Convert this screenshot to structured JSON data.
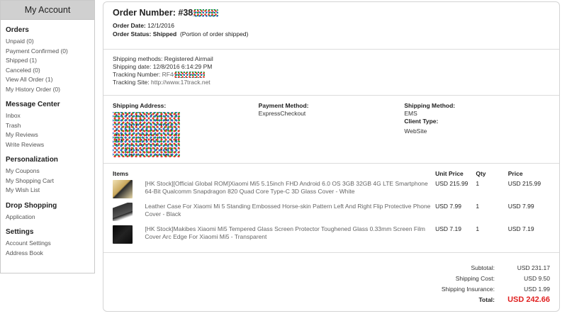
{
  "sidebar": {
    "title": "My Account",
    "sections": [
      {
        "title": "Orders",
        "links": [
          "Unpaid (0)",
          "Payment Confirmed (0)",
          "Shipped (1)",
          "Canceled (0)",
          "View All Order (1)",
          "My History Order (0)"
        ]
      },
      {
        "title": "Message Center",
        "links": [
          "Inbox",
          "Trash",
          "My Reviews",
          "Write Reviews"
        ]
      },
      {
        "title": "Personalization",
        "links": [
          "My Coupons",
          "My Shopping Cart",
          "My Wish List"
        ]
      },
      {
        "title": "Drop Shopping",
        "links": [
          "Application"
        ]
      },
      {
        "title": "Settings",
        "links": [
          "Account Settings",
          "Address Book"
        ]
      }
    ]
  },
  "order": {
    "number_label": "Order Number:",
    "number_prefix": "#38",
    "date_label": "Order Date:",
    "date": "12/1/2016",
    "status_label": "Order Status:",
    "status": "Shipped",
    "status_note": "(Portion of order shipped)"
  },
  "shipping": {
    "methods_label": "Shipping methods:",
    "methods": "Registered Airmail",
    "date_label": "Shipping date:",
    "date": "12/8/2016 6:14:29 PM",
    "tracking_label": "Tracking Number:",
    "tracking_prefix": "RF4",
    "site_label": "Tracking Site:",
    "site": "http://www.17track.net"
  },
  "address": {
    "shipping_address_label": "Shipping Address:",
    "payment_method_label": "Payment Method:",
    "payment_method": "ExpressCheckout",
    "shipping_method_label": "Shipping Method:",
    "shipping_method": "EMS",
    "client_type_label": "Client Type:",
    "client_type": "WebSite"
  },
  "items_table": {
    "headers": [
      "Items",
      "Unit Price",
      "Qty",
      "Price"
    ],
    "rows": [
      {
        "name": "[HK Stock][Official Global ROM]Xiaomi Mi5 5.15inch FHD Android 6.0 OS 3GB 32GB 4G LTE Smartphone 64-Bit Qualcomm Snapdragon 820 Quad Core Type-C 3D Glass Cover - White",
        "unit_price": "USD 215.99",
        "qty": "1",
        "price": "USD 215.99",
        "thumb_color": "#c8b47a"
      },
      {
        "name": "Leather Case For Xiaomi Mi 5 Standing Embossed Horse-skin Pattern Left And Right Flip Protective Phone Cover - Black",
        "unit_price": "USD 7.99",
        "qty": "1",
        "price": "USD 7.99",
        "thumb_color": "#3a3a3a"
      },
      {
        "name": "[HK Stock]Makibes Xiaomi Mi5 Tempered Glass Screen Protector Toughened Glass 0.33mm Screen Film Cover Arc Edge For Xiaomi Mi5 - Transparent",
        "unit_price": "USD 7.19",
        "qty": "1",
        "price": "USD 7.19",
        "thumb_color": "#111111"
      }
    ]
  },
  "totals": {
    "subtotal_label": "Subtotal:",
    "subtotal": "USD 231.17",
    "shipping_cost_label": "Shipping Cost:",
    "shipping_cost": "USD 9.50",
    "insurance_label": "Shipping Insurance:",
    "insurance": "USD 1.99",
    "total_label": "Total:",
    "total": "USD 242.66"
  }
}
